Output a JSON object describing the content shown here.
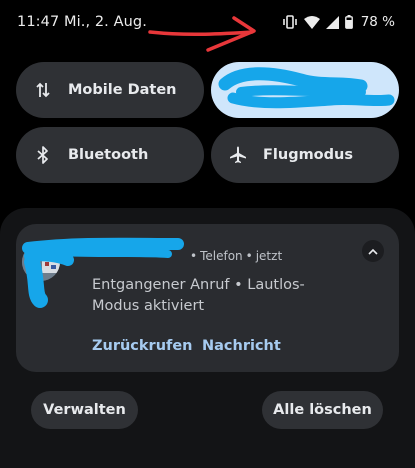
{
  "status_bar": {
    "time_date": "11:47 Mi., 2. Aug.",
    "battery_percent": "78 %",
    "icons": [
      "vibrate-icon",
      "wifi-icon",
      "cell-signal-icon",
      "battery-icon"
    ]
  },
  "quick_tiles": [
    {
      "label": "Mobile Daten",
      "icon": "mobile-data-arrows-icon",
      "active": false
    },
    {
      "label": "",
      "icon": "wifi-icon",
      "active": true,
      "redacted": true
    },
    {
      "label": "Bluetooth",
      "icon": "bluetooth-icon",
      "active": false
    },
    {
      "label": "Flugmodus",
      "icon": "airplane-icon",
      "active": false
    }
  ],
  "notification": {
    "app": "Telefon",
    "time": "jetzt",
    "separator": "•",
    "text": "Entgangener Anruf • Lautlos-Modus aktiviert",
    "actions": [
      "Zurückrufen",
      "Nachricht"
    ]
  },
  "footer": {
    "manage_label": "Verwalten",
    "clear_all_label": "Alle löschen"
  },
  "colors": {
    "background": "#000000",
    "tile": "#2f3135",
    "tile_active": "#cfe6fb",
    "card": "#2a2c30",
    "accent_text": "#a6cbf0",
    "annotation_red": "#e8373a",
    "redaction_blue": "#16a6ea"
  }
}
